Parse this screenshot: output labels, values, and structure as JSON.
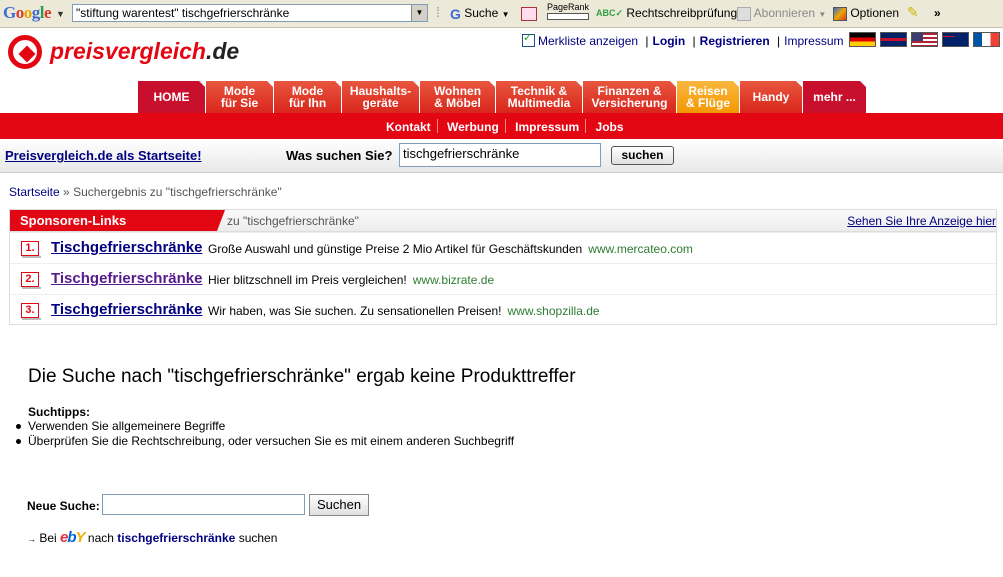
{
  "toolbar": {
    "logo": "Google",
    "query": "\"stiftung warentest\" tischgefrierschränke",
    "search_label": "Suche",
    "pagerank_label": "PageRank",
    "spellcheck_label": "Rechtschreibprüfung",
    "subscribe_label": "Abonnieren",
    "options_label": "Optionen",
    "more_label": "»"
  },
  "header": {
    "logo_main": "preisvergleich",
    "logo_tld": ".de",
    "watchlist_label": "Merkliste anzeigen",
    "login_label": "Login",
    "register_label": "Registrieren",
    "imprint_label": "Impressum",
    "flags": [
      "german-flag",
      "uk-flag",
      "us-flag",
      "australia-flag",
      "france-flag"
    ]
  },
  "nav": {
    "tabs": [
      {
        "line1": "HOME",
        "line2": ""
      },
      {
        "line1": "Mode",
        "line2": "für Sie"
      },
      {
        "line1": "Mode",
        "line2": "für Ihn"
      },
      {
        "line1": "Haushalts-",
        "line2": "geräte"
      },
      {
        "line1": "Wohnen",
        "line2": "& Möbel"
      },
      {
        "line1": "Technik &",
        "line2": "Multimedia"
      },
      {
        "line1": "Finanzen &",
        "line2": "Versicherung"
      },
      {
        "line1": "Reisen",
        "line2": "& Flüge"
      },
      {
        "line1": "Handy",
        "line2": ""
      },
      {
        "line1": "mehr ...",
        "line2": ""
      }
    ],
    "subnav": [
      "Kontakt",
      "Werbung",
      "Impressum",
      "Jobs"
    ]
  },
  "searchbar": {
    "startpage_link": "Preisvergleich.de als Startseite!",
    "label": "Was suchen Sie?",
    "value": "tischgefrierschränke",
    "button": "suchen"
  },
  "breadcrumb": {
    "home": "Startseite",
    "separator": "»",
    "current": "Suchergebnis zu \"tischgefrierschränke\""
  },
  "sponsored": {
    "heading": "Sponsoren-Links",
    "query": "zu \"tischgefrierschränke\"",
    "advertise_link": "Sehen Sie Ihre Anzeige hier",
    "ads": [
      {
        "num": "1.",
        "title": "Tischgefrierschränke",
        "desc": "Große Auswahl und günstige Preise 2 Mio Artikel für Geschäftskunden",
        "url": "www.mercateo.com"
      },
      {
        "num": "2.",
        "title": "Tischgefrierschränke",
        "desc": "Hier blitzschnell im Preis vergleichen!",
        "url": "www.bizrate.de"
      },
      {
        "num": "3.",
        "title": "Tischgefrierschränke",
        "desc": "Wir haben, was Sie suchen. Zu sensationellen Preisen!",
        "url": "www.shopzilla.de"
      }
    ]
  },
  "results": {
    "no_results": "Die Suche nach \"tischgefrierschränke\" ergab keine Produkttreffer",
    "tips_heading": "Suchtipps:",
    "tips": [
      "Verwenden Sie allgemeinere Begriffe",
      "Überprüfen Sie die Rechtschreibung, oder versuchen Sie es mit einem anderen Suchbegriff"
    ],
    "new_search_label": "Neue Suche:",
    "new_search_value": "",
    "new_search_button": "Suchen",
    "ebay_prefix": "Bei",
    "ebay_logo": "ebY",
    "ebay_middle": "nach",
    "ebay_term": "tischgefrierschränke",
    "ebay_suffix": "suchen"
  },
  "colors": {
    "brand_red": "#e30613",
    "tab_orange": "#f49800",
    "link_blue": "#000080",
    "url_green": "#2e7d32"
  }
}
